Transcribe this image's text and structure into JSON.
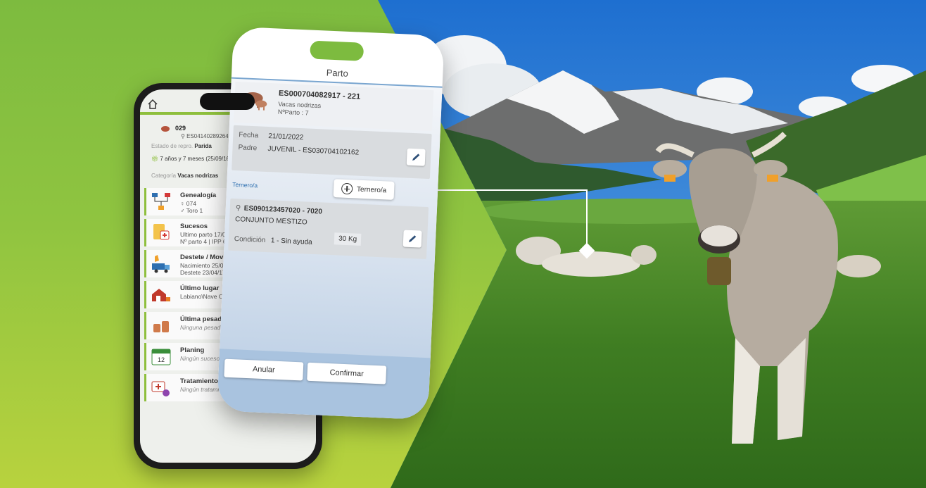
{
  "colors": {
    "brand_green": "#8ebf3d",
    "accent_blue": "#2e6fb0"
  },
  "back_phone": {
    "animal": {
      "id": "029",
      "code": "ES041402892645",
      "repro_label": "Estado de repro.",
      "repro_value": "Parida",
      "age": "7 años y 7 meses (25/09/16)",
      "category_label": "Categoría",
      "category_value": "Vacas nodrizas"
    },
    "items": [
      {
        "title": "Genealogía",
        "line1": "♀ 074",
        "line2": "♂ Toro 1",
        "icon": "pedigree-icon"
      },
      {
        "title": "Sucesos",
        "line1": "Ultimo parto 17/01/2",
        "line2": "Nº parto 4 | IPP 613",
        "icon": "events-icon"
      },
      {
        "title": "Destete / Movimie",
        "line1": "Nacimiento 25/09/",
        "line2": "Destete 23/04/17",
        "icon": "truck-icon"
      },
      {
        "title": "Último lugar",
        "line1": "Labiano\\Nave O",
        "line2": "",
        "icon": "farm-icon"
      },
      {
        "title": "Última pesada",
        "line1": "Ninguna pesad",
        "line2": "",
        "icon": "weight-icon"
      },
      {
        "title": "Planing",
        "line1": "Ningún suceso",
        "line2": "",
        "icon": "calendar-icon",
        "calendar_day": "12"
      },
      {
        "title": "Tratamientos",
        "line1": "Ningún tratamie",
        "line2": "",
        "icon": "medkit-icon"
      }
    ]
  },
  "front_phone": {
    "title": "Parto",
    "mother": {
      "code": "ES000704082917 - 221",
      "category": "Vacas nodrizas",
      "parto": "NºParto : 7"
    },
    "fecha_label": "Fecha",
    "fecha_value": "21/01/2022",
    "padre_label": "Padre",
    "padre_value": "JUVENIL - ES030704102162",
    "ternero_label": "Ternero/a",
    "ternero_button": "Ternero/a",
    "calf": {
      "code": "ES090123457020 - 7020",
      "breed": "CONJUNTO MESTIZO",
      "weight": "30 Kg",
      "condition_label": "Condición",
      "condition_value": "1 - Sin ayuda"
    },
    "cancel_label": "Anular",
    "confirm_label": "Confirmar"
  }
}
